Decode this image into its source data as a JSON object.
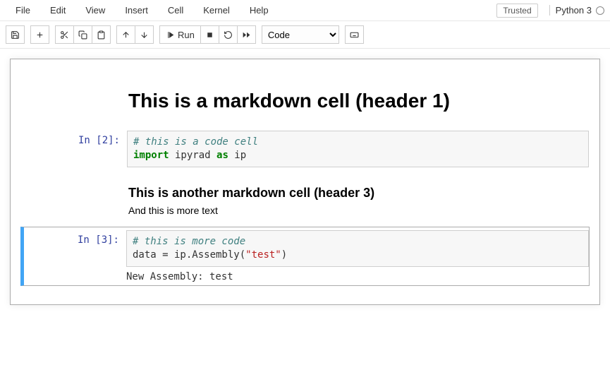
{
  "menu": {
    "file": "File",
    "edit": "Edit",
    "view": "View",
    "insert": "Insert",
    "cell": "Cell",
    "kernel": "Kernel",
    "help": "Help"
  },
  "header": {
    "trusted": "Trusted",
    "kernel_name": "Python 3"
  },
  "toolbar": {
    "run_label": "Run",
    "celltype": "Code"
  },
  "cells": {
    "md1_h1": "This is a markdown cell (header 1)",
    "c1_prompt": "In [2]:",
    "c1_comment": "# this is a code cell",
    "c1_kw1": "import",
    "c1_mod": " ipyrad ",
    "c1_kw2": "as",
    "c1_alias": " ip",
    "md2_h3": "This is another markdown cell (header 3)",
    "md2_p": "And this is more text",
    "c2_prompt": "In [3]:",
    "c2_comment": "# this is more code",
    "c2_code_a": "data = ip.Assembly(",
    "c2_str": "\"test\"",
    "c2_code_b": ")",
    "c2_output": "New Assembly: test"
  }
}
